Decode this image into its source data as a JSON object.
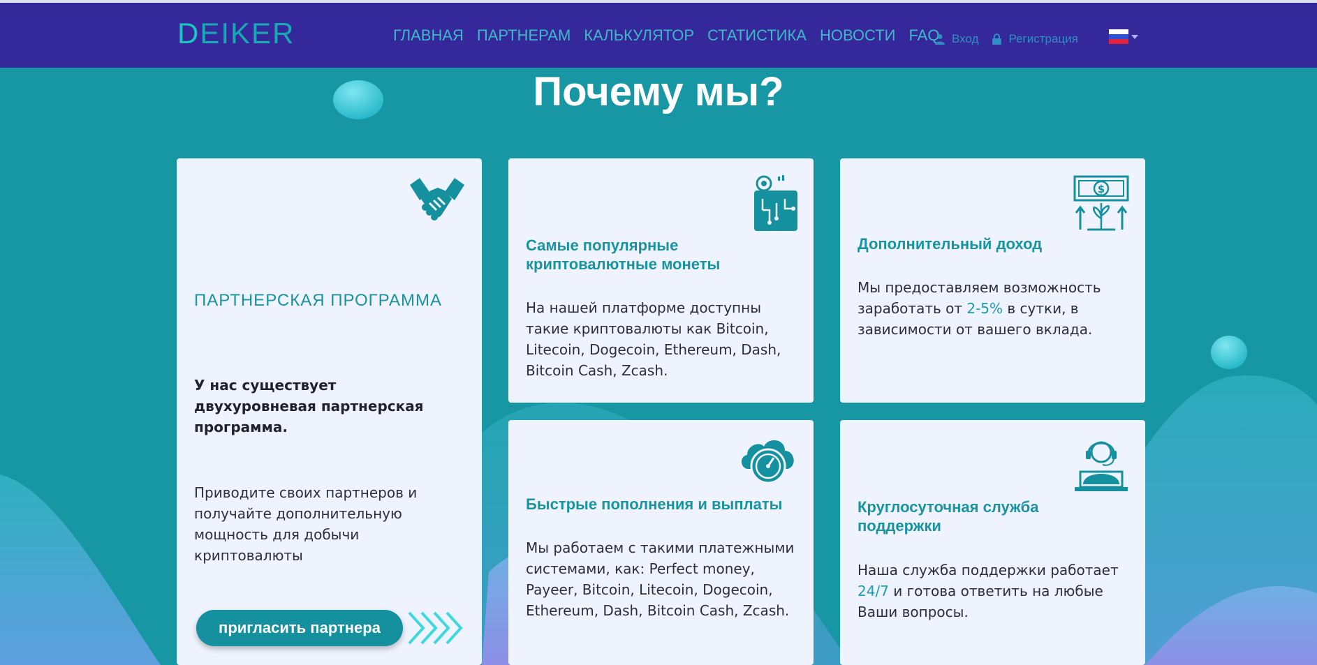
{
  "brand": {
    "logo_first": "D",
    "logo_rest": "EIKER"
  },
  "nav": {
    "items": [
      {
        "label": "ГЛАВНАЯ"
      },
      {
        "label": "ПАРТНЕРАМ"
      },
      {
        "label": "КАЛЬКУЛЯТОР"
      },
      {
        "label": "СТАТИСТИКА"
      },
      {
        "label": "НОВОСТИ"
      },
      {
        "label": "FAQ"
      }
    ],
    "login": "Вход",
    "register": "Регистрация",
    "language_flag": "ru-flag-icon"
  },
  "section": {
    "title": "Почему мы?"
  },
  "cards": {
    "partner": {
      "icon": "handshake-icon",
      "title": "ПАРТНЕРСКАЯ ПРОГРАММА",
      "bold_text": "У нас существует двухуровневая партнерская программа.",
      "text": "Приводите своих партнеров и получайте дополнительную мощность для добычи криптовалюты",
      "button": "пригласить партнера",
      "button_arrows_icon": "chevrons-right-icon"
    },
    "coins": {
      "icon": "crypto-wallet-icon",
      "title": "Самые популярные криптовалютные монеты",
      "text": "На нашей платформе доступны такие криптовалюты как Bitcoin, Litecoin, Dogecoin, Ethereum, Dash, Bitcoin Cash, Zcash."
    },
    "income": {
      "icon": "money-growth-icon",
      "title": "Дополнительный доход",
      "text_before": "Мы предоставляем возможность заработать от ",
      "highlight": "2-5%",
      "text_after": " в сутки, в зависимости от вашего вклада."
    },
    "payments": {
      "icon": "cloud-speedometer-icon",
      "title": "Быстрые пополнения и выплаты",
      "text": "Мы работаем с такими платежными системами, как: Perfect money, Payeer, Bitcoin, Litecoin, Dogecoin, Ethereum, Dash, Bitcoin Cash, Zcash."
    },
    "support": {
      "icon": "support-operator-icon",
      "title": "Круглосуточная служба поддержки",
      "text_before": "Наша служба поддержки работает ",
      "highlight": "24/7",
      "text_after": " и готова ответить на любые Ваши вопросы."
    }
  },
  "colors": {
    "nav_bg": "#35289a",
    "page_bg": "#1797a4",
    "accent": "#1a93a0",
    "card_bg": "#eff3fd"
  }
}
